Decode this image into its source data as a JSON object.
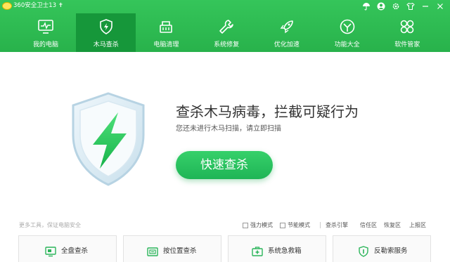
{
  "app": {
    "title": "360安全卫士13 ✝",
    "logo_icon": "360-logo"
  },
  "titlebar_icons": [
    "umbrella-icon",
    "avatar-icon",
    "gear-icon",
    "shirt-icon",
    "minimize-icon",
    "close-icon"
  ],
  "nav": [
    {
      "label": "我的电脑",
      "icon": "monitor-icon"
    },
    {
      "label": "木马查杀",
      "icon": "shield-bolt-icon",
      "active": true
    },
    {
      "label": "电脑清理",
      "icon": "broom-icon"
    },
    {
      "label": "系统修复",
      "icon": "wrench-icon"
    },
    {
      "label": "优化加速",
      "icon": "rocket-icon"
    },
    {
      "label": "功能大全",
      "icon": "cube-icon"
    },
    {
      "label": "软件管家",
      "icon": "grid-flower-icon"
    }
  ],
  "main": {
    "headline": "查杀木马病毒，拦截可疑行为",
    "subtitle": "您还未进行木马扫描，请立即扫描",
    "scan_button": "快速查杀",
    "illustration_icon": "shield-lightning-icon"
  },
  "tools_bar": {
    "label": "更多工具，保证电脑安全",
    "options": [
      {
        "label": "强力模式",
        "checked": false
      },
      {
        "label": "节能模式",
        "checked": false
      }
    ],
    "links": [
      "查杀引擎",
      "信任区",
      "恢复区",
      "上报区"
    ]
  },
  "tools": [
    {
      "label": "全盘查杀",
      "icon": "monitor-scan-icon"
    },
    {
      "label": "按位置查杀",
      "icon": "folder-scan-icon"
    },
    {
      "label": "系统急救箱",
      "icon": "first-aid-icon"
    },
    {
      "label": "反勒索服务",
      "icon": "shield-check-icon"
    }
  ],
  "colors": {
    "header": "#2db84f",
    "nav_active": "#16973a",
    "accent": "#22b75a",
    "headline_text": "#333333"
  }
}
